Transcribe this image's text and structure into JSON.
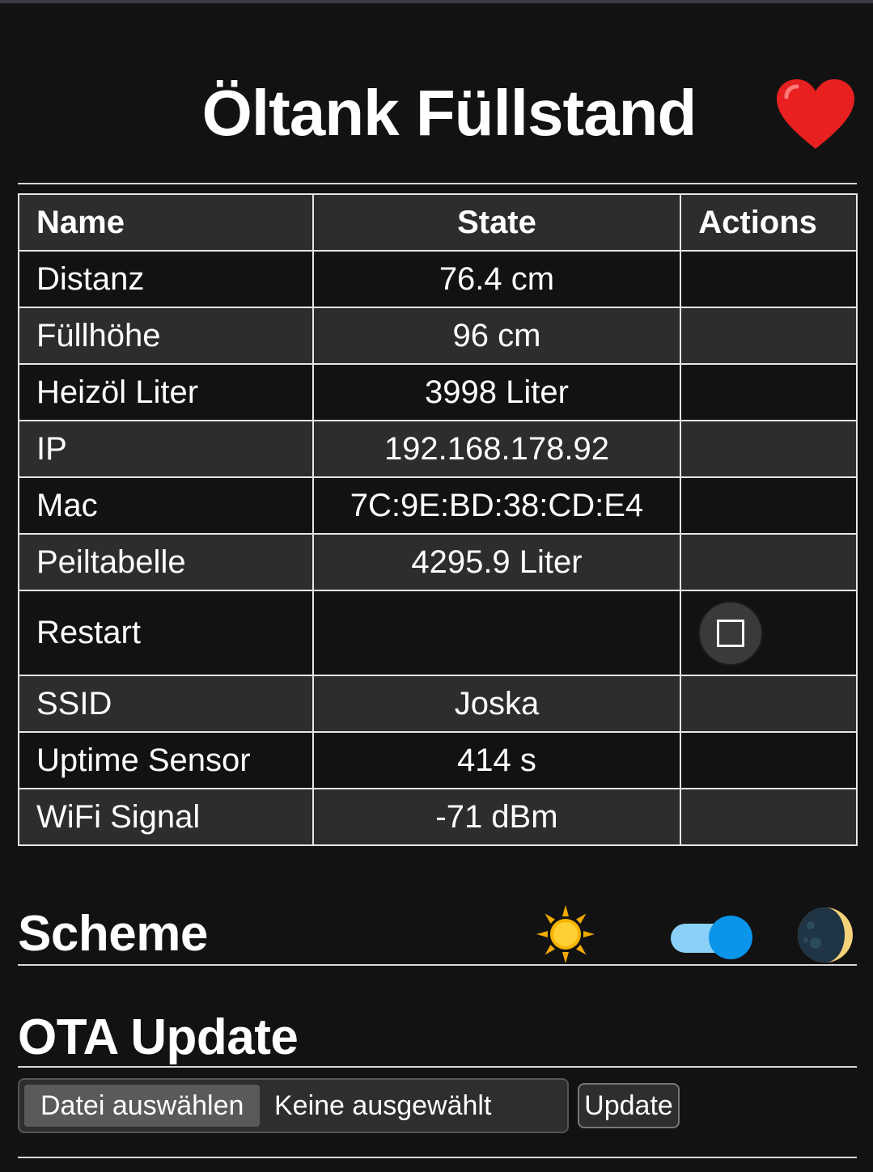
{
  "header": {
    "title": "Öltank Füllstand",
    "heart_icon": "heart-icon"
  },
  "table": {
    "columns": [
      "Name",
      "State",
      "Actions"
    ],
    "rows": [
      {
        "name": "Distanz",
        "state": "76.4 cm"
      },
      {
        "name": "Füllhöhe",
        "state": "96 cm"
      },
      {
        "name": "Heizöl Liter",
        "state": "3998 Liter"
      },
      {
        "name": "IP",
        "state": "192.168.178.92"
      },
      {
        "name": "Mac",
        "state": "7C:9E:BD:38:CD:E4"
      },
      {
        "name": "Peiltabelle",
        "state": "4295.9 Liter"
      },
      {
        "name": "Restart",
        "state": "",
        "action_icon": "stop-square-icon"
      },
      {
        "name": "SSID",
        "state": "Joska"
      },
      {
        "name": "Uptime Sensor",
        "state": "414 s"
      },
      {
        "name": "WiFi Signal",
        "state": "-71 dBm"
      }
    ]
  },
  "scheme": {
    "title": "Scheme",
    "light_icon": "sun-icon",
    "dark_icon": "moon-icon",
    "dark_mode_enabled": true,
    "accent": "#0a95ea"
  },
  "ota": {
    "title": "OTA Update",
    "choose_file_label": "Datei auswählen",
    "file_status": "Keine ausgewählt",
    "update_label": "Update"
  }
}
